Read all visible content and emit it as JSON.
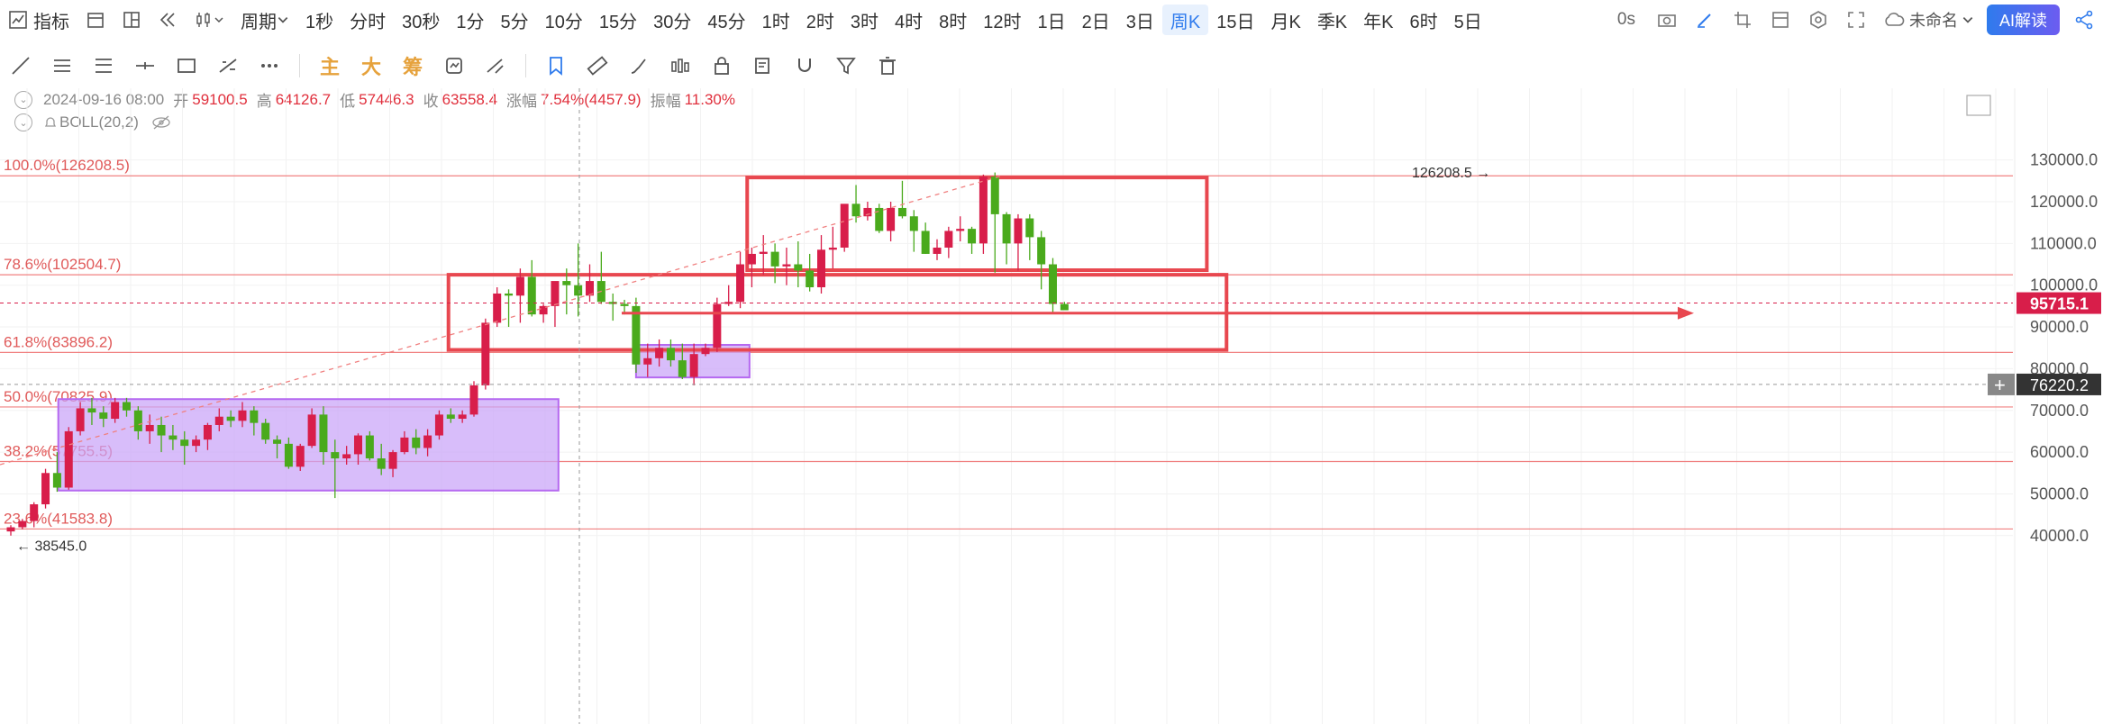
{
  "toolbar": {
    "indicator_label": "指标",
    "period_label": "周期",
    "periods": [
      "1秒",
      "分时",
      "30秒",
      "1分",
      "5分",
      "10分",
      "15分",
      "30分",
      "45分",
      "1时",
      "2时",
      "3时",
      "4时",
      "8时",
      "12时",
      "1日",
      "2日",
      "3日",
      "周K",
      "15日",
      "月K",
      "季K",
      "年K",
      "6时",
      "5日"
    ],
    "active_period": "周K",
    "countdown": "0s",
    "user_label": "未命名",
    "ai_label": "AI解读"
  },
  "drawing_tools": {
    "main_label": "主",
    "big_label": "大",
    "chip_label": "筹"
  },
  "ohlc": {
    "date": "2024-09-16 08:00",
    "open_label": "开",
    "open": "59100.5",
    "high_label": "高",
    "high": "64126.7",
    "low_label": "低",
    "low": "57446.3",
    "close_label": "收",
    "close": "63558.4",
    "change_label": "涨幅",
    "change": "7.54%(4457.9)",
    "amplitude_label": "振幅",
    "amplitude": "11.30%"
  },
  "indicator": {
    "name": "BOLL(20,2)"
  },
  "colors": {
    "up": "#d81e4a",
    "down": "#4aaa1c",
    "fib": "#f08080",
    "box_red": "#e8474f",
    "box_purple": "#c9a4f8",
    "accent": "#2f7bed"
  },
  "chart_data": {
    "type": "candlestick",
    "timeframe": "周K",
    "ylim": [
      37000,
      135000
    ],
    "price_ticks": [
      "130000.0",
      "120000.0",
      "110000.0",
      "100000.0",
      "90000.0",
      "80000.0",
      "70000.0",
      "60000.0",
      "50000.0",
      "40000.0"
    ],
    "current_price": "95715.1",
    "crosshair_price": "76220.2",
    "high_label": "126208.5",
    "low_label": "38545.0",
    "fib_levels": [
      {
        "label": "100.0%(126208.5)",
        "value": 126208.5
      },
      {
        "label": "78.6%(102504.7)",
        "value": 102504.7
      },
      {
        "label": "61.8%(83896.2)",
        "value": 83896.2
      },
      {
        "label": "50.0%(70825.9)",
        "value": 70825.9
      },
      {
        "label": "38.2%(57755.5)",
        "value": 57755.5
      },
      {
        "label": "23.6%(41583.8)",
        "value": 41583.8
      }
    ],
    "candles": [
      [
        41000,
        42500,
        40000,
        42000
      ],
      [
        42000,
        44000,
        41500,
        43500
      ],
      [
        43500,
        48000,
        42000,
        47500
      ],
      [
        47500,
        56000,
        46500,
        55000
      ],
      [
        55000,
        60000,
        50500,
        51500
      ],
      [
        51500,
        66000,
        51000,
        65000
      ],
      [
        65000,
        72000,
        64000,
        70500
      ],
      [
        70500,
        73000,
        66500,
        69500
      ],
      [
        69500,
        71000,
        66000,
        68000
      ],
      [
        68000,
        73000,
        67000,
        72000
      ],
      [
        72000,
        73000,
        68500,
        70000
      ],
      [
        70000,
        71000,
        63000,
        65000
      ],
      [
        65000,
        69000,
        62000,
        66500
      ],
      [
        66500,
        68500,
        60000,
        64000
      ],
      [
        64000,
        66500,
        60500,
        63000
      ],
      [
        63000,
        65000,
        57000,
        61500
      ],
      [
        61500,
        64000,
        60000,
        63000
      ],
      [
        63000,
        67000,
        60500,
        66500
      ],
      [
        66500,
        70500,
        65000,
        68500
      ],
      [
        68500,
        70000,
        66000,
        67500
      ],
      [
        67500,
        72000,
        66000,
        70000
      ],
      [
        70000,
        71000,
        64000,
        67000
      ],
      [
        67000,
        68000,
        62000,
        63000
      ],
      [
        63000,
        64000,
        58500,
        62000
      ],
      [
        62000,
        63500,
        56000,
        56500
      ],
      [
        56500,
        62000,
        55500,
        61500
      ],
      [
        61500,
        70500,
        61000,
        69000
      ],
      [
        69000,
        71000,
        57000,
        60000
      ],
      [
        60000,
        63000,
        49000,
        58500
      ],
      [
        58500,
        61500,
        57000,
        59500
      ],
      [
        59500,
        64500,
        57000,
        64000
      ],
      [
        64000,
        65000,
        58000,
        58500
      ],
      [
        58500,
        62000,
        54500,
        56000
      ],
      [
        56000,
        60500,
        54000,
        60000
      ],
      [
        60000,
        65000,
        59500,
        63500
      ],
      [
        63500,
        65500,
        59500,
        61000
      ],
      [
        61000,
        65500,
        59000,
        64000
      ],
      [
        64000,
        70000,
        63000,
        69000
      ],
      [
        69000,
        70500,
        67000,
        68000
      ],
      [
        68000,
        70000,
        67000,
        69000
      ],
      [
        69000,
        77000,
        68500,
        76000
      ],
      [
        76000,
        92000,
        75000,
        91000
      ],
      [
        91000,
        99500,
        90000,
        98000
      ],
      [
        98000,
        99000,
        90000,
        97500
      ],
      [
        97500,
        104000,
        91000,
        102000
      ],
      [
        102000,
        106000,
        92500,
        93000
      ],
      [
        93000,
        95500,
        91000,
        95000
      ],
      [
        95000,
        100000,
        90000,
        101000
      ],
      [
        101000,
        104000,
        93000,
        100000
      ],
      [
        100000,
        110000,
        92500,
        97500
      ],
      [
        97500,
        105000,
        96000,
        101000
      ],
      [
        101000,
        108000,
        95500,
        96000
      ],
      [
        96000,
        98000,
        91500,
        95500
      ],
      [
        95500,
        96500,
        93000,
        95000
      ],
      [
        95000,
        97000,
        79000,
        81000
      ],
      [
        81000,
        86000,
        78000,
        82500
      ],
      [
        82500,
        87000,
        80500,
        85000
      ],
      [
        85000,
        87000,
        80500,
        82000
      ],
      [
        82000,
        86000,
        77500,
        78000
      ],
      [
        78000,
        86000,
        76000,
        83500
      ],
      [
        83500,
        86000,
        83000,
        85000
      ],
      [
        85000,
        97000,
        84000,
        95500
      ],
      [
        95500,
        100000,
        95000,
        96000
      ],
      [
        96000,
        108000,
        94500,
        105000
      ],
      [
        105000,
        109000,
        99500,
        107500
      ],
      [
        107500,
        112000,
        102500,
        108000
      ],
      [
        108000,
        110000,
        100500,
        104500
      ],
      [
        104500,
        109000,
        100000,
        105000
      ],
      [
        105000,
        110500,
        99500,
        103500
      ],
      [
        103500,
        107500,
        98500,
        99500
      ],
      [
        99500,
        112000,
        98000,
        108500
      ],
      [
        108500,
        114000,
        104000,
        109000
      ],
      [
        109000,
        119000,
        108000,
        119500
      ],
      [
        119500,
        124000,
        115000,
        116500
      ],
      [
        116500,
        120000,
        115500,
        118500
      ],
      [
        118500,
        119500,
        112500,
        113000
      ],
      [
        113000,
        120000,
        110500,
        118500
      ],
      [
        118500,
        125000,
        116000,
        116500
      ],
      [
        116500,
        118000,
        108000,
        113000
      ],
      [
        113000,
        115000,
        107500,
        107500
      ],
      [
        107500,
        111000,
        106000,
        109000
      ],
      [
        109000,
        114000,
        106500,
        113000
      ],
      [
        113000,
        116500,
        110500,
        113500
      ],
      [
        113500,
        114000,
        107500,
        110000
      ],
      [
        110000,
        126500,
        107500,
        126000
      ],
      [
        126000,
        127000,
        103000,
        117000
      ],
      [
        117000,
        117500,
        105000,
        110000
      ],
      [
        110000,
        117000,
        103500,
        116000
      ],
      [
        116000,
        117000,
        106000,
        111500
      ],
      [
        111500,
        113000,
        99000,
        105000
      ],
      [
        105000,
        106500,
        93500,
        95500
      ],
      [
        95500,
        96000,
        94000,
        94000
      ]
    ]
  }
}
